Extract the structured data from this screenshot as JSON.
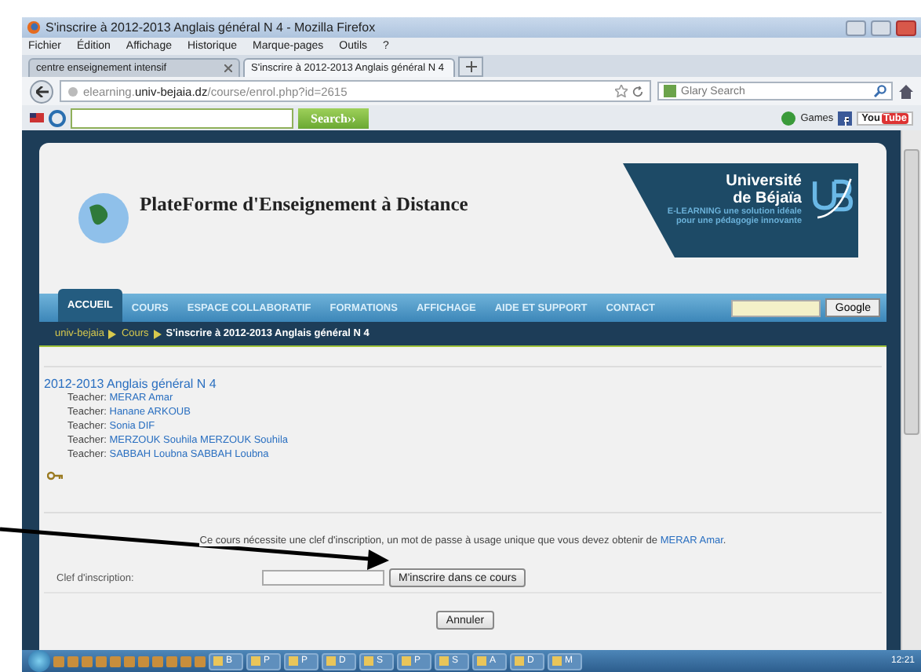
{
  "window": {
    "title": "S'inscrire à 2012-2013 Anglais général N 4 - Mozilla Firefox"
  },
  "menu": [
    "Fichier",
    "Édition",
    "Affichage",
    "Historique",
    "Marque-pages",
    "Outils",
    "?"
  ],
  "tabs": [
    {
      "label": "centre enseignement intensif",
      "selected": false
    },
    {
      "label": "S'inscrire à 2012-2013 Anglais général N 4",
      "selected": true
    }
  ],
  "address": {
    "prefix": "elearning.",
    "host": "univ-bejaia.dz",
    "path": "/course/enrol.php?id=2615"
  },
  "browser_search": {
    "placeholder": "Glary Search"
  },
  "toolbar": {
    "search_button": "Search››",
    "games": "Games",
    "youtube_left": "You",
    "youtube_right": "Tube"
  },
  "site": {
    "title": "PlateForme d'Enseignement à Distance",
    "university_line1": "Université",
    "university_line2": "de Béjaïa",
    "tagline": "**E-LEARNING** une solution idéale",
    "tagline_line2": "pour une pédagogie innovante",
    "nav": [
      {
        "label": "ACCUEIL",
        "selected": true
      },
      {
        "label": "COURS",
        "selected": false
      },
      {
        "label": "ESPACE COLLABORATIF",
        "selected": false
      },
      {
        "label": "FORMATIONS",
        "selected": false
      },
      {
        "label": "AFFICHAGE",
        "selected": false
      },
      {
        "label": "AIDE ET SUPPORT",
        "selected": false
      },
      {
        "label": "CONTACT",
        "selected": false
      }
    ],
    "google_button": "Google",
    "breadcrumb": [
      "univ-bejaia",
      "Cours",
      "S'inscrire à 2012-2013 Anglais général N 4"
    ]
  },
  "course": {
    "title": "2012-2013 Anglais général N 4",
    "teachers": [
      {
        "label": "Teacher:",
        "name": "MERAR Amar"
      },
      {
        "label": "Teacher:",
        "name": "Hanane ARKOUB"
      },
      {
        "label": "Teacher:",
        "name": "Sonia DIF"
      },
      {
        "label": "Teacher:",
        "name": "MERZOUK Souhila MERZOUK Souhila"
      },
      {
        "label": "Teacher:",
        "name": "SABBAH Loubna SABBAH Loubna"
      }
    ]
  },
  "enrol": {
    "notice": "Ce cours nécessite une clef d'inscription, un mot de passe à usage unique que vous devez obtenir de",
    "notice_link": "MERAR Amar",
    "notice_end": ".",
    "key_label": "Clef d'inscription:",
    "submit": "M'inscrire dans ce cours",
    "cancel": "Annuler"
  },
  "taskbar": {
    "items": [
      "B",
      "P",
      "P",
      "D",
      "S",
      "P",
      "S",
      "A",
      "D",
      "M"
    ],
    "clock": "12:21"
  }
}
